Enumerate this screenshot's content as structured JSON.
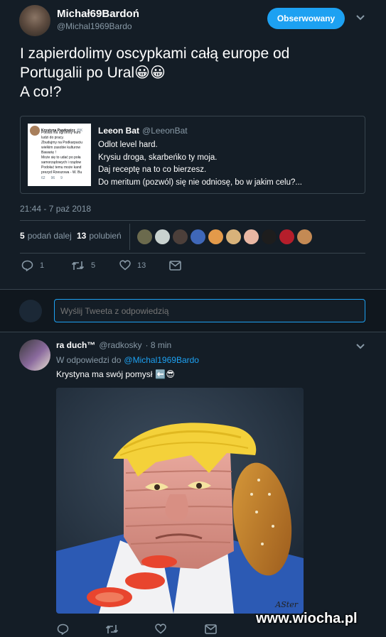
{
  "tweet": {
    "display_name": "Michał69Bardoń",
    "handle": "@Michal1969Bardo",
    "follow_button": "Obserwowany",
    "text_line1": "I zapierdolimy  oscypkami całą europe od",
    "text_line2": "Portugalii po Ural",
    "text_emoji": "😀😀",
    "text_line3": "A co!?",
    "timestamp": "21:44 - 7 paź 2018",
    "retweets_count": "5",
    "retweets_label": "podań dalej",
    "likes_count": "13",
    "likes_label": "polubień",
    "actions": {
      "reply": "1",
      "retweet": "5",
      "like": "13"
    }
  },
  "quoted": {
    "display_name": "Leeon Bat",
    "handle": "@LeeonBat",
    "lines": [
      "Odlot level hard.",
      "Krysiu droga, skarbeńko ty moja.",
      "Daj receptę na to co bierzesz.",
      "Do meritum (pozwól) się nie odniosę, bo w jakim celu?..."
    ],
    "thumb": {
      "name": "Krystyna Pawłowicz",
      "handle": "@K",
      "lines": [
        "Polska ma ogromny euro",
        "ludzi do pracy.",
        "Zbudujmy na Podkarpaciu",
        "wielkim zasobie kulturow",
        "Bawarię !",
        "Może się to udać po poła",
        "samorządowych i rządow",
        "Podołać temu może kand",
        "prezyd  Rzeszowa - W. Bu"
      ],
      "stat1": "62",
      "stat2": "96",
      "stat3": "9"
    }
  },
  "reply_box": {
    "placeholder": "Wyślij Tweeta z odpowiedzią"
  },
  "reply": {
    "display_name": "ra duch™",
    "handle": "@radkosky",
    "time": "· 8 min",
    "in_reply_prefix": "W odpowiedzi do",
    "in_reply_handle": "@Michal1969Bardo",
    "text": "Krystyna ma swój pomysł",
    "text_emoji": "⬅️😎",
    "image_signature": "ASter"
  },
  "watermark": "www.wiocha.pl",
  "colors": {
    "background": "#141d26",
    "accent": "#1da1f2",
    "muted": "#8899a6",
    "border": "#38444d"
  }
}
